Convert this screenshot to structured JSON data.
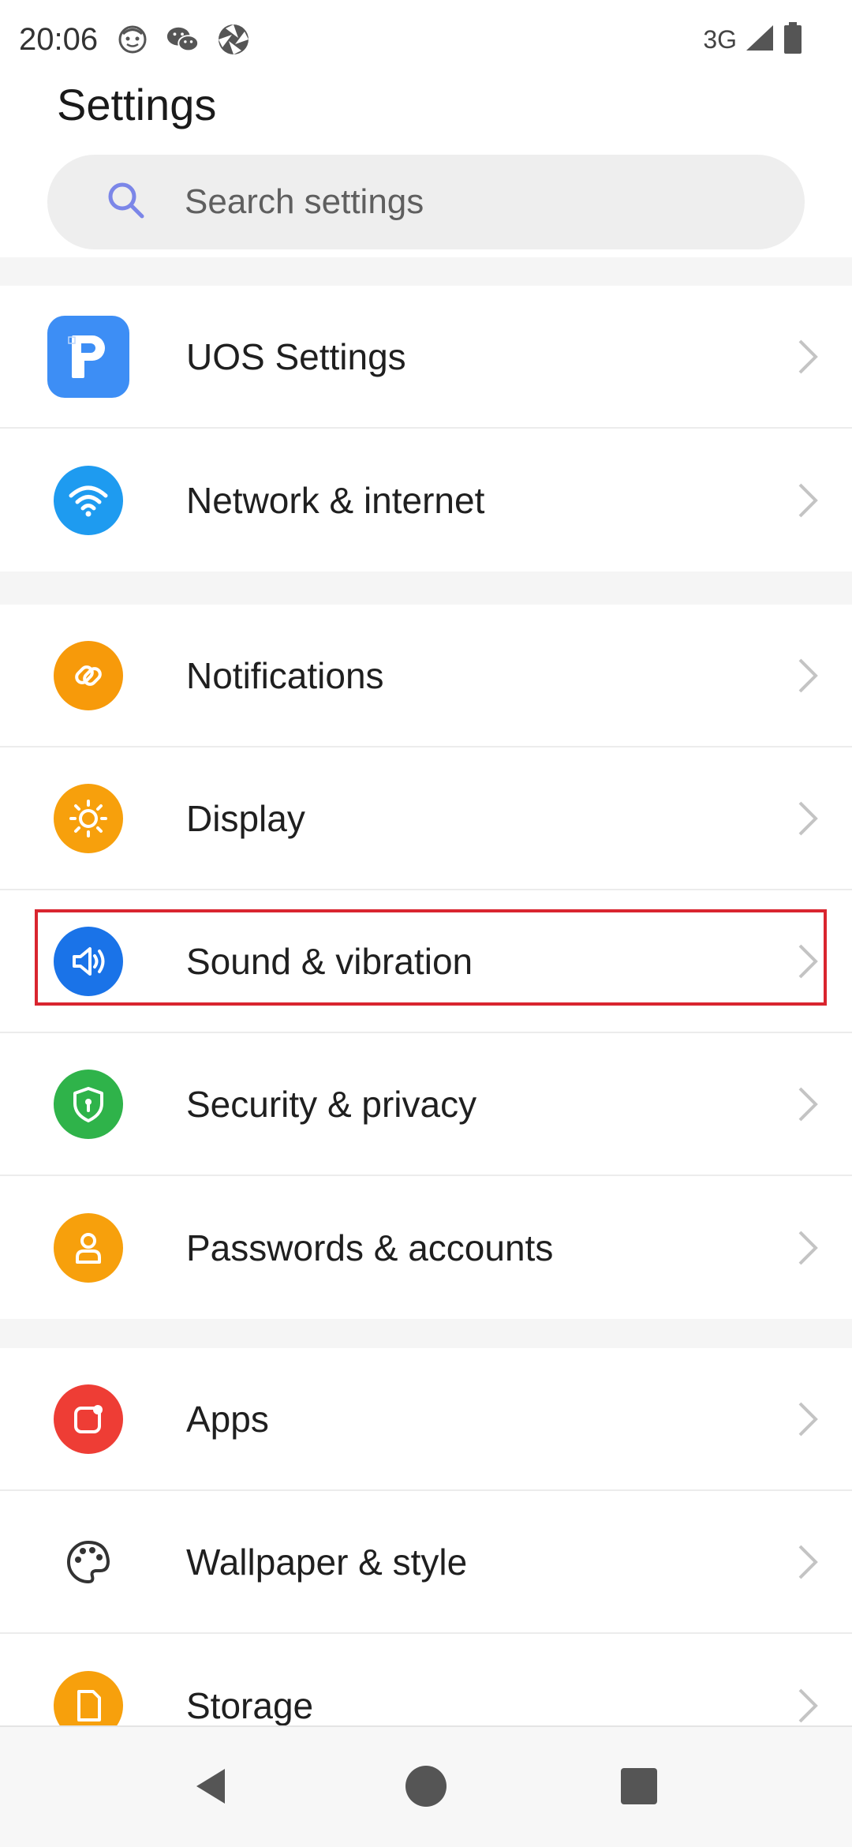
{
  "status_bar": {
    "time": "20:06",
    "network": "3G",
    "left_icons": [
      "face-icon",
      "wechat-icon",
      "aperture-icon"
    ],
    "right_icons": [
      "signal-icon",
      "battery-icon"
    ]
  },
  "header": {
    "title": "Settings",
    "search_placeholder": "Search settings"
  },
  "groups": [
    {
      "items": [
        {
          "label": "UOS Settings",
          "icon": "uos-app-icon",
          "color": "#3d8ef5"
        },
        {
          "label": "Network & internet",
          "icon": "wifi-icon",
          "color": "#1e9bf0"
        }
      ]
    },
    {
      "items": [
        {
          "label": "Notifications",
          "icon": "link-icon",
          "color": "#f79a0a"
        },
        {
          "label": "Display",
          "icon": "sun-icon",
          "color": "#f7a00c"
        },
        {
          "label": "Sound & vibration",
          "icon": "speaker-icon",
          "color": "#1a73e8",
          "highlighted": true
        },
        {
          "label": "Security & privacy",
          "icon": "shield-icon",
          "color": "#2fb34a"
        },
        {
          "label": "Passwords & accounts",
          "icon": "person-icon",
          "color": "#f7a00c"
        }
      ]
    },
    {
      "items": [
        {
          "label": "Apps",
          "icon": "apps-icon",
          "color": "#ee3d35"
        },
        {
          "label": "Wallpaper & style",
          "icon": "palette-icon",
          "color": "#333333"
        },
        {
          "label": "Storage",
          "icon": "storage-icon",
          "color": "#f7a00c"
        }
      ]
    }
  ],
  "nav_bar": {
    "buttons": [
      "back-icon",
      "home-icon",
      "recents-icon"
    ]
  }
}
